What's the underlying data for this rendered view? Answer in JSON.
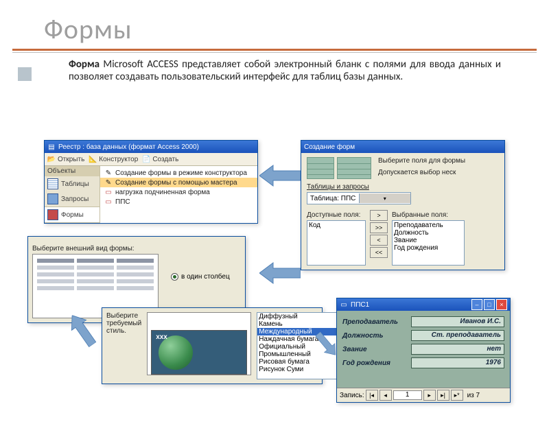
{
  "slide": {
    "title": "Формы",
    "body_bold": "Форма",
    "body_rest": " Microsoft ACCESS представляет собой электронный бланк с полями для ввода данных и позволяет создавать пользовательский интерфейс для таблиц базы данных."
  },
  "registry": {
    "title": "Реестр : база данных (формат Access 2000)",
    "toolbar": {
      "open": "Открыть",
      "design": "Конструктор",
      "create": "Создать"
    },
    "sidebar_header": "Объекты",
    "sidebar": {
      "tables": "Таблицы",
      "queries": "Запросы",
      "forms": "Формы"
    },
    "list": [
      "Создание формы в режиме конструктора",
      "Создание формы с помощью мастера",
      "нагрузка подчиненная форма",
      "ППС"
    ]
  },
  "wizard": {
    "title": "Создание форм",
    "hint1": "Выберите поля для формы",
    "hint2": "Допускается выбор неск",
    "tables_label": "Таблицы и запросы",
    "table_value": "Таблица: ППС",
    "avail_label": "Доступные поля:",
    "sel_label": "Выбранные поля:",
    "avail": [
      "Код"
    ],
    "selected": [
      "Преподаватель",
      "Должность",
      "Звание",
      "Год рождения"
    ]
  },
  "layout": {
    "prompt": "Выберите внешний вид формы:",
    "option": "в один столбец"
  },
  "style": {
    "prompt": "Выберите требуемый стиль.",
    "preview_label": "xxx",
    "items": [
      "Диффузный",
      "Камень",
      "Международный",
      "Наждачная бумага",
      "Официальный",
      "Промышленный",
      "Рисовая бумага",
      "Рисунок Суми"
    ]
  },
  "form": {
    "title": "ППС1",
    "rows": [
      {
        "label": "Преподаватель",
        "value": "Иванов И.С."
      },
      {
        "label": "Должность",
        "value": "Ст. преподаватель"
      },
      {
        "label": "Звание",
        "value": "нет"
      },
      {
        "label": "Год рождения",
        "value": "1976"
      }
    ],
    "nav": {
      "label": "Запись:",
      "current": "1",
      "of": "из 7"
    }
  }
}
